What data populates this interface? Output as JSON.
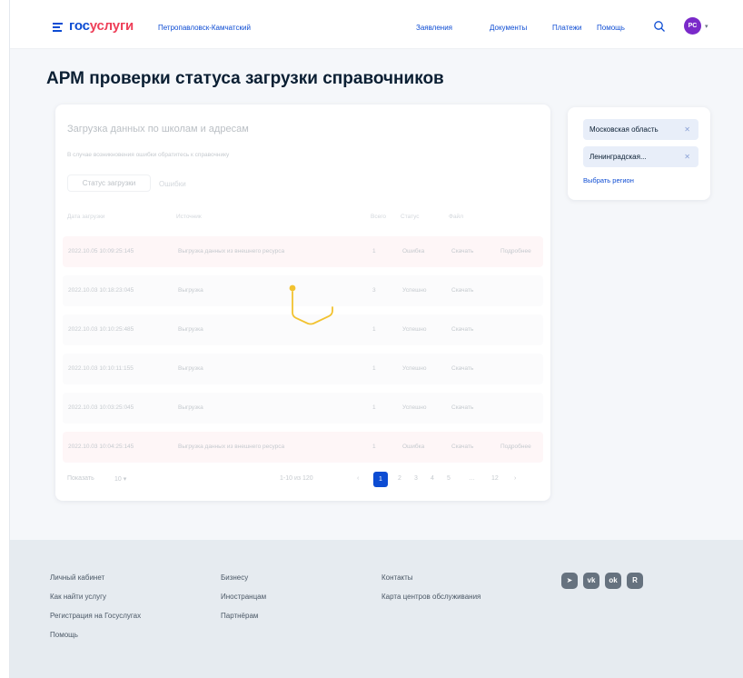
{
  "header": {
    "logo_part1": "гос",
    "logo_part2": "услуги",
    "location": "Петропавловск-Камчатский",
    "nav": [
      "Заявления",
      "Документы",
      "Платежи",
      "Помощь"
    ],
    "avatar_initials": "PC"
  },
  "page": {
    "title": "АРМ проверки статуса загрузки справочников"
  },
  "card": {
    "title": "Загрузка данных по школам и адресам",
    "hint": "В случае возникновения ошибки обратитесь к справочнику",
    "tabs": [
      "Статус загрузки",
      "Ошибки"
    ],
    "columns": [
      "Дата загрузки",
      "Источник",
      "Всего",
      "Статус",
      "Файл"
    ],
    "rows": [
      {
        "date": "2022.10.05 10:09:25:145",
        "source": "Выгрузка данных из внешнего ресурса",
        "count": "1",
        "status": "Ошибка",
        "file": "Скачать",
        "action": "Подробнее",
        "state": "error"
      },
      {
        "date": "2022.10.03 10:18:23:045",
        "source": "Выгрузка",
        "count": "3",
        "status": "Успешно",
        "file": "Скачать",
        "action": "",
        "state": "ok"
      },
      {
        "date": "2022.10.03 10:10:25:485",
        "source": "Выгрузка",
        "count": "1",
        "status": "Успешно",
        "file": "Скачать",
        "action": "",
        "state": "ok"
      },
      {
        "date": "2022.10.03 10:10:11:155",
        "source": "Выгрузка",
        "count": "1",
        "status": "Успешно",
        "file": "Скачать",
        "action": "",
        "state": "ok"
      },
      {
        "date": "2022.10.03 10:03:25:045",
        "source": "Выгрузка",
        "count": "1",
        "status": "Успешно",
        "file": "Скачать",
        "action": "",
        "state": "ok"
      },
      {
        "date": "2022.10.03 10:04:25:145",
        "source": "Выгрузка данных из внешнего ресурса",
        "count": "1",
        "status": "Ошибка",
        "file": "Скачать",
        "action": "Подробнее",
        "state": "error"
      }
    ],
    "pager": {
      "label": "Показать",
      "page_size": "10",
      "range": "1-10 из 120",
      "pages": [
        "‹",
        "1",
        "2",
        "3",
        "4",
        "5",
        "…",
        "12",
        "›"
      ],
      "active_page": "1"
    }
  },
  "filter": {
    "chips": [
      "Московская область",
      "Ленинградская..."
    ],
    "select_region": "Выбрать регион"
  },
  "footer": {
    "col1": [
      "Личный кабинет",
      "Как найти услугу",
      "Регистрация на Госуслугах",
      "Помощь"
    ],
    "col2": [
      "Бизнесу",
      "Иностранцам",
      "Партнёрам"
    ],
    "col3": [
      "Контакты",
      "Карта центров обслуживания"
    ],
    "social": [
      {
        "icon": "telegram-icon",
        "glyph": "➤"
      },
      {
        "icon": "vk-icon",
        "glyph": "vk"
      },
      {
        "icon": "ok-icon",
        "glyph": "ok"
      },
      {
        "icon": "rutube-icon",
        "glyph": "R"
      }
    ]
  },
  "colors": {
    "brand_blue": "#0d4cd3",
    "brand_red": "#ee3f58",
    "avatar": "#7a29c9",
    "spinner": "#f2c230"
  }
}
